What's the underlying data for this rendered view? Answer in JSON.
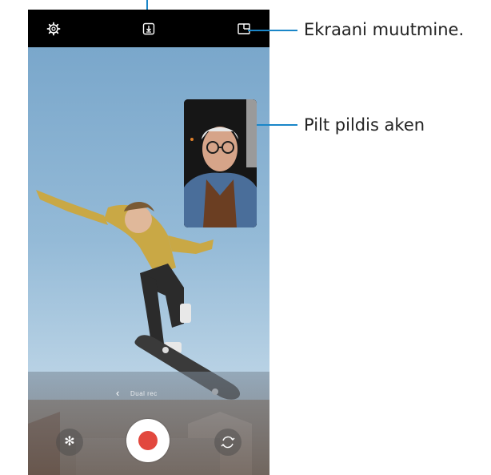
{
  "screen": {
    "top_bar": {
      "settings_icon": "gear-icon",
      "recording_icon": "download-icon",
      "split_view_icon": "split-screen-icon"
    },
    "bottom_bar": {
      "mode_label": "Dual rec",
      "shutter_color": "#e2483e",
      "effects_icon": "flower-icon",
      "switch_camera_icon": "camera-switch-icon"
    }
  },
  "callouts": {
    "split_screen": "Ekraani muutmine.",
    "pip_window": "Pilt pildis aken"
  },
  "colors": {
    "callout_line": "#1a86c8",
    "top_bar": "#000000",
    "record": "#e2483e"
  }
}
